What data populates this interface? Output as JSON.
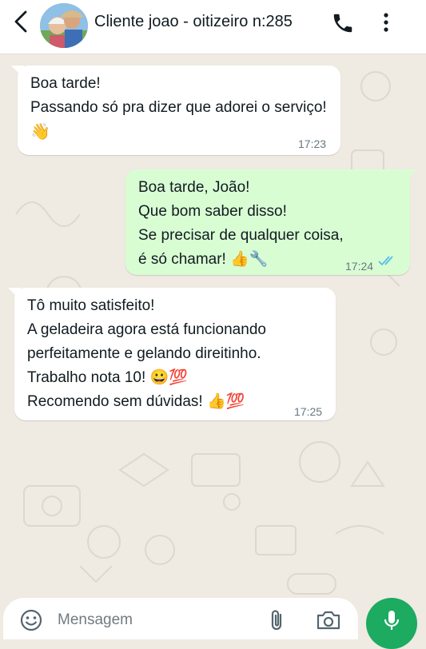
{
  "header": {
    "contact_name": "Cliente joao - oitizeiro n:285",
    "icons": [
      "back-arrow-icon",
      "avatar",
      "phone-icon",
      "more-vert-icon"
    ]
  },
  "messages": [
    {
      "direction": "incoming",
      "lines": [
        "Boa tarde!",
        "Passando só pra dizer que adorei o serviço!",
        "👋"
      ],
      "time": "17:23"
    },
    {
      "direction": "outgoing",
      "lines": [
        "Boa tarde, João!",
        "Que bom saber disso!",
        "Se precisar de qualquer coisa,",
        "é só chamar! 👍🔧"
      ],
      "time": "17:24",
      "status": "read"
    },
    {
      "direction": "incoming",
      "lines": [
        "Tô muito satisfeito!",
        "A geladeira agora está funcionando",
        "perfeitamente e gelando direitinho.",
        "Trabalho nota 10! 😀💯",
        "Recomendo sem dúvidas! 👍💯"
      ],
      "time": "17:25"
    }
  ],
  "composer": {
    "placeholder": "Mensagem",
    "icons": [
      "emoji-icon",
      "attach-icon",
      "camera-icon",
      "mic-icon"
    ]
  },
  "colors": {
    "background": "#efeae2",
    "incoming_bubble": "#ffffff",
    "outgoing_bubble": "#d9fdd3",
    "read_ticks": "#53bdeb",
    "mic_button": "#1daa61"
  }
}
